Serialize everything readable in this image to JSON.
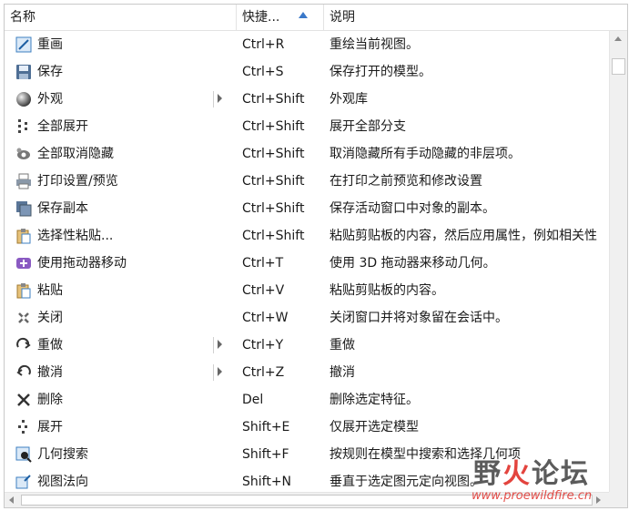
{
  "header": {
    "col_name": "名称",
    "col_shortcut": "快捷...",
    "col_desc": "说明"
  },
  "rows": [
    {
      "name": "重画",
      "shortcut": "Ctrl+R",
      "desc": "重绘当前视图。",
      "icon": "repaint-icon",
      "submenu": false
    },
    {
      "name": "保存",
      "shortcut": "Ctrl+S",
      "desc": "保存打开的模型。",
      "icon": "save-icon",
      "submenu": false
    },
    {
      "name": "外观",
      "shortcut": "Ctrl+Shift",
      "desc": "外观库",
      "icon": "appearance-sphere-icon",
      "submenu": true
    },
    {
      "name": "全部展开",
      "shortcut": "Ctrl+Shift",
      "desc": "展开全部分支",
      "icon": "expand-all-icon",
      "submenu": false
    },
    {
      "name": "全部取消隐藏",
      "shortcut": "Ctrl+Shift",
      "desc": "取消隐藏所有手动隐藏的非层项。",
      "icon": "unhide-all-icon",
      "submenu": false
    },
    {
      "name": "打印设置/预览",
      "shortcut": "Ctrl+Shift",
      "desc": "在打印之前预览和修改设置",
      "icon": "print-preview-icon",
      "submenu": false
    },
    {
      "name": "保存副本",
      "shortcut": "Ctrl+Shift",
      "desc": "保存活动窗口中对象的副本。",
      "icon": "save-copy-icon",
      "submenu": false
    },
    {
      "name": "选择性粘贴...",
      "shortcut": "Ctrl+Shift",
      "desc": "粘贴剪贴板的内容，然后应用属性，例如相关性",
      "icon": "paste-special-icon",
      "submenu": false
    },
    {
      "name": "使用拖动器移动",
      "shortcut": "Ctrl+T",
      "desc": "使用 3D 拖动器来移动几何。",
      "icon": "dragger-move-icon",
      "submenu": false
    },
    {
      "name": "粘贴",
      "shortcut": "Ctrl+V",
      "desc": "粘贴剪贴板的内容。",
      "icon": "paste-icon",
      "submenu": false
    },
    {
      "name": "关闭",
      "shortcut": "Ctrl+W",
      "desc": "关闭窗口并将对象留在会话中。",
      "icon": "close-window-icon",
      "submenu": false
    },
    {
      "name": "重做",
      "shortcut": "Ctrl+Y",
      "desc": "重做",
      "icon": "redo-icon",
      "submenu": true
    },
    {
      "name": "撤消",
      "shortcut": "Ctrl+Z",
      "desc": "撤消",
      "icon": "undo-icon",
      "submenu": true
    },
    {
      "name": "删除",
      "shortcut": "Del",
      "desc": "删除选定特征。",
      "icon": "delete-icon",
      "submenu": false
    },
    {
      "name": "展开",
      "shortcut": "Shift+E",
      "desc": "仅展开选定模型",
      "icon": "expand-icon",
      "submenu": false
    },
    {
      "name": "几何搜索",
      "shortcut": "Shift+F",
      "desc": "按规则在模型中搜索和选择几何项",
      "icon": "geometry-search-icon",
      "submenu": false
    },
    {
      "name": "视图法向",
      "shortcut": "Shift+N",
      "desc": "垂直于选定图元定向视图。",
      "icon": "view-normal-icon",
      "submenu": false
    }
  ],
  "watermark": {
    "text_pre": "野",
    "text_red": "火",
    "text_post": "论坛",
    "url": "www.proewildfire.cn"
  }
}
